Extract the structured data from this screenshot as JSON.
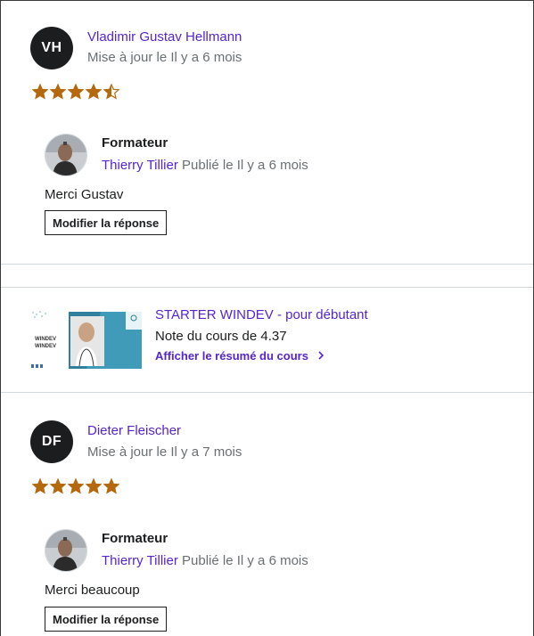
{
  "reviews": [
    {
      "initials": "VH",
      "name": "Vladimir Gustav Hellmann",
      "meta": "Mise à jour le Il y a 6 mois",
      "rating": 4.5,
      "response": {
        "role": "Formateur",
        "instructor": "Thierry Tillier",
        "published": "Publié le Il y a 6 mois",
        "text": "Merci Gustav",
        "edit_label": "Modifier la réponse"
      }
    },
    {
      "initials": "DF",
      "name": "Dieter Fleischer",
      "meta": "Mise à jour le Il y a 7 mois",
      "rating": 5,
      "response": {
        "role": "Formateur",
        "instructor": "Thierry Tillier",
        "published": "Publié le Il y a 6 mois",
        "text": "Merci beaucoup",
        "edit_label": "Modifier la réponse"
      }
    }
  ],
  "course": {
    "title": "STARTER WINDEV - pour débutant",
    "rating_text": "Note du cours de 4.37",
    "summary_link": "Afficher le résumé du cours",
    "thumb_text": [
      "WINDEV",
      "WINDEV"
    ],
    "chevron_icon": "chevron-right-icon"
  },
  "colors": {
    "star": "#b4690e",
    "link": "#5624d0",
    "muted": "#6a6f73",
    "text": "#1c1d1f"
  }
}
